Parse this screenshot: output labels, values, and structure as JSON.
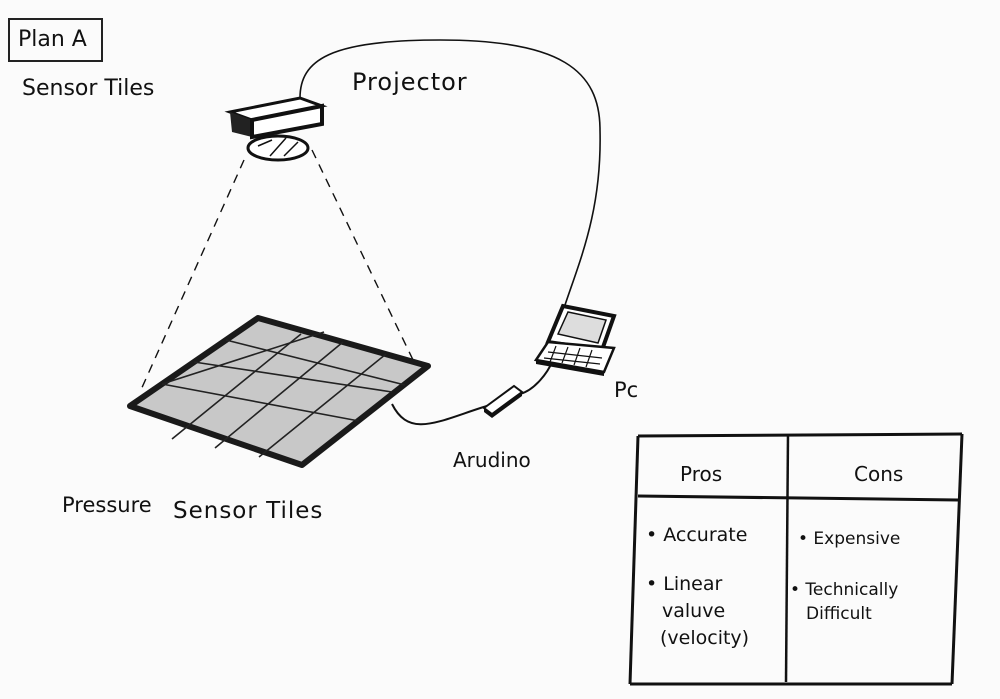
{
  "plan_label": "Plan A",
  "sensor_tiles_top": "Sensor Tiles",
  "projector_label": "Projector",
  "pc_label": "Pc",
  "arduino_label": "Arudino",
  "pressure_label": "Pressure",
  "sensor_tiles_bottom": "Sensor Tiles",
  "table": {
    "pros_header": "Pros",
    "cons_header": "Cons",
    "pros": [
      "• Accurate",
      "• Linear",
      "valuve",
      "(velocity)"
    ],
    "cons": [
      "• Expensive",
      "• Technically",
      "Difficult"
    ]
  },
  "colors": {
    "ink": "#111111",
    "tile_gray": "#c8c8c8",
    "paper": "#fbfbfb"
  }
}
